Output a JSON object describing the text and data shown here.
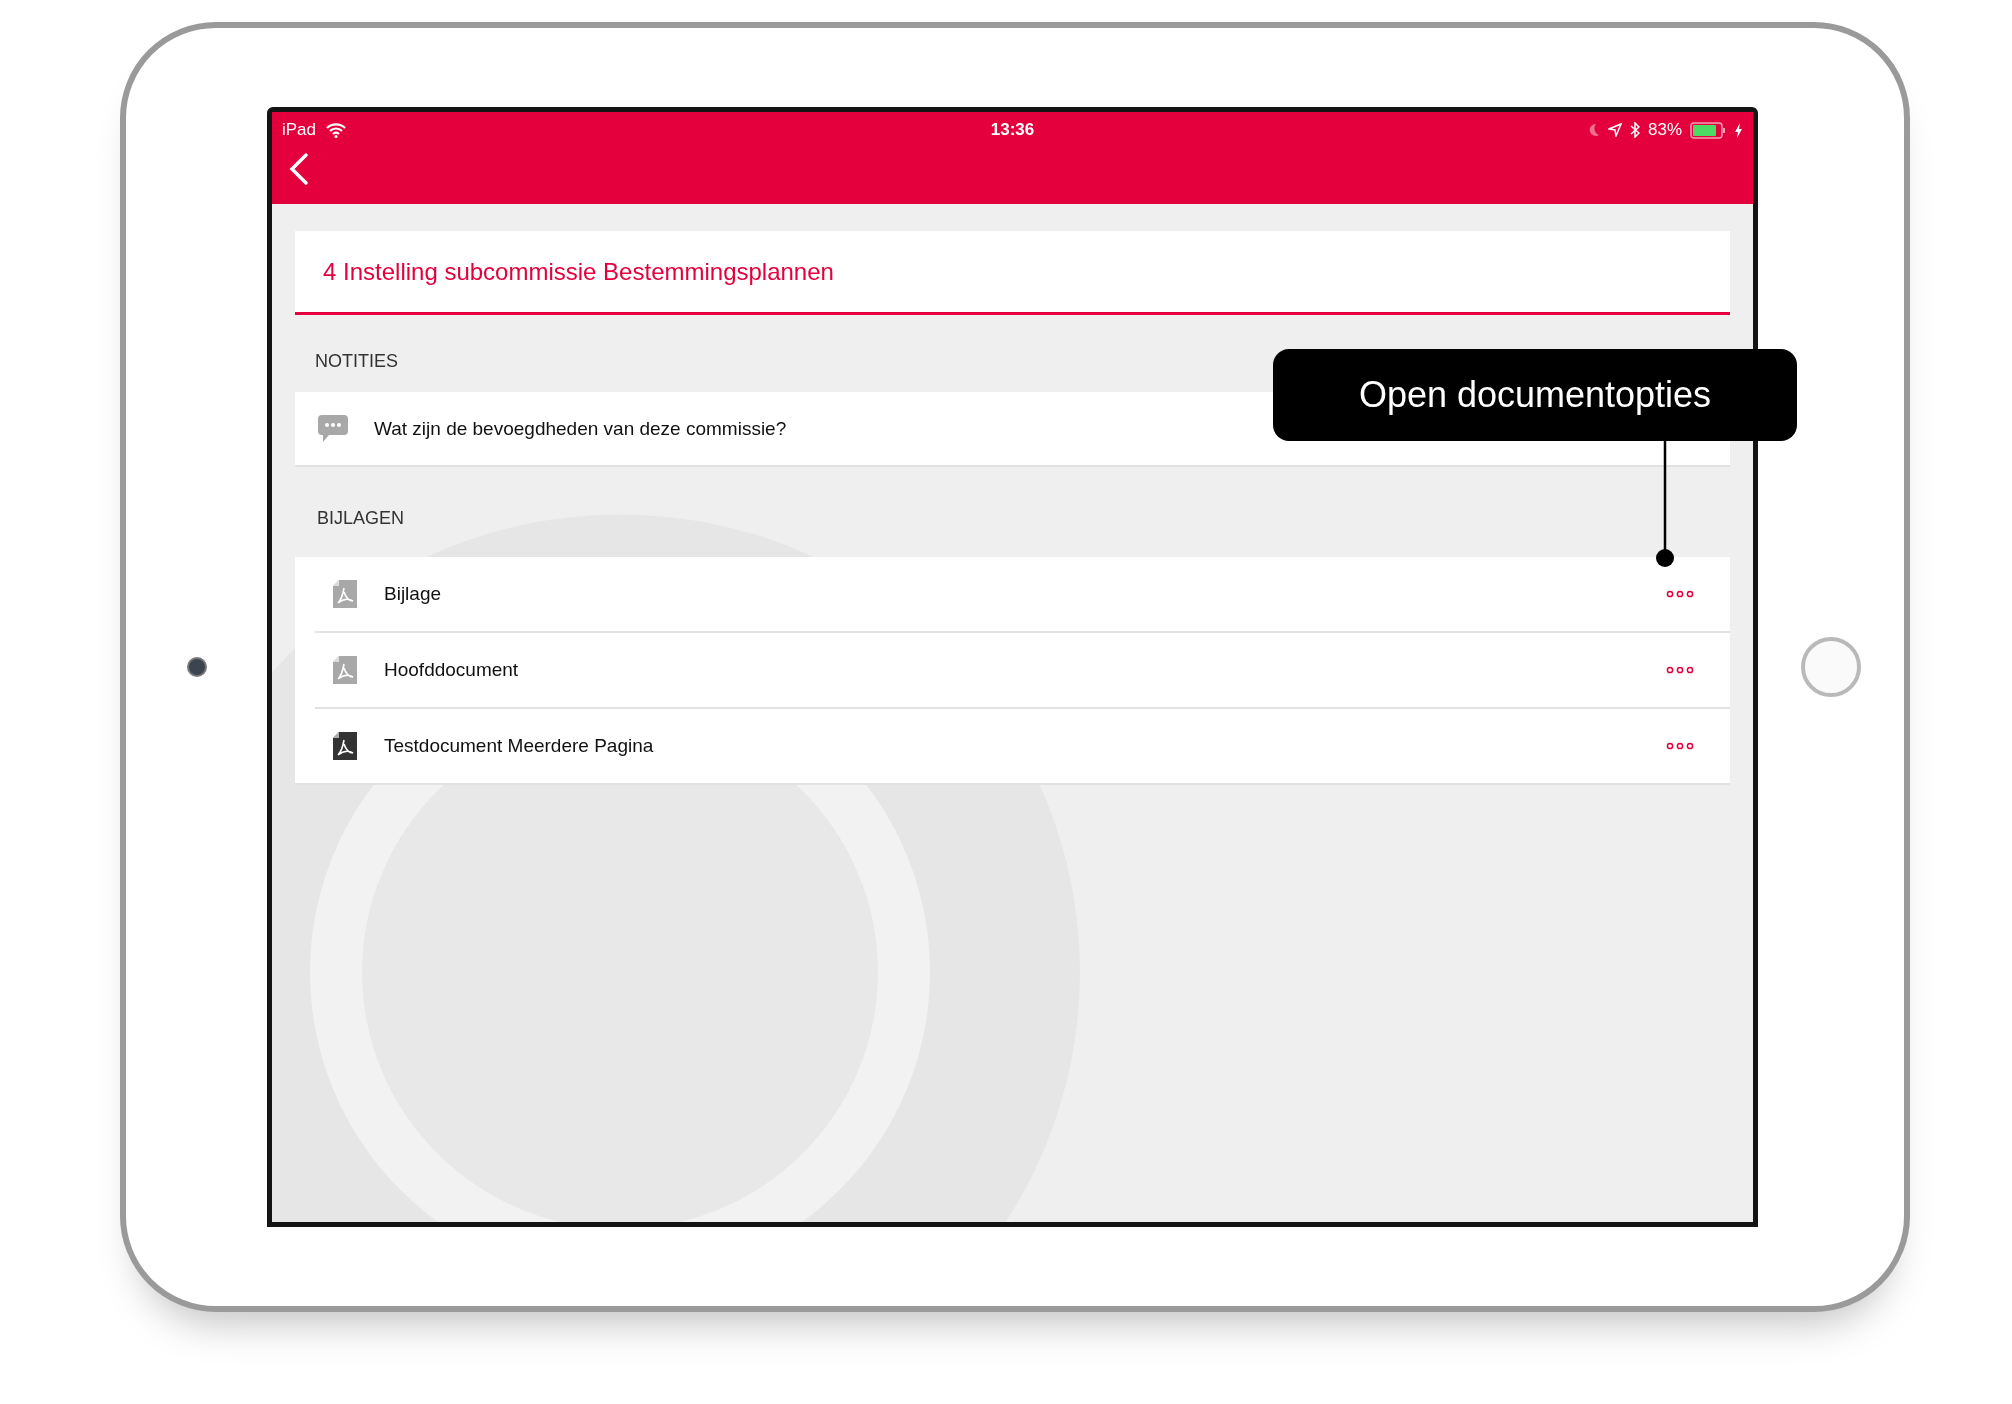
{
  "status_bar": {
    "device": "iPad",
    "time": "13:36",
    "battery": "83%"
  },
  "header": {
    "title": "4 Instelling subcommissie Bestemmingsplannen"
  },
  "notes": {
    "heading": "NOTITIES",
    "items": [
      {
        "text": "Wat zijn de bevoegdheden van deze commissie?"
      }
    ]
  },
  "attachments": {
    "heading": "BIJLAGEN",
    "items": [
      {
        "name": "Bijlage",
        "downloaded": false
      },
      {
        "name": "Hoofddocument",
        "downloaded": false
      },
      {
        "name": "Testdocument Meerdere Pagina",
        "downloaded": true
      }
    ]
  },
  "tooltip": {
    "text": "Open documentopties"
  }
}
